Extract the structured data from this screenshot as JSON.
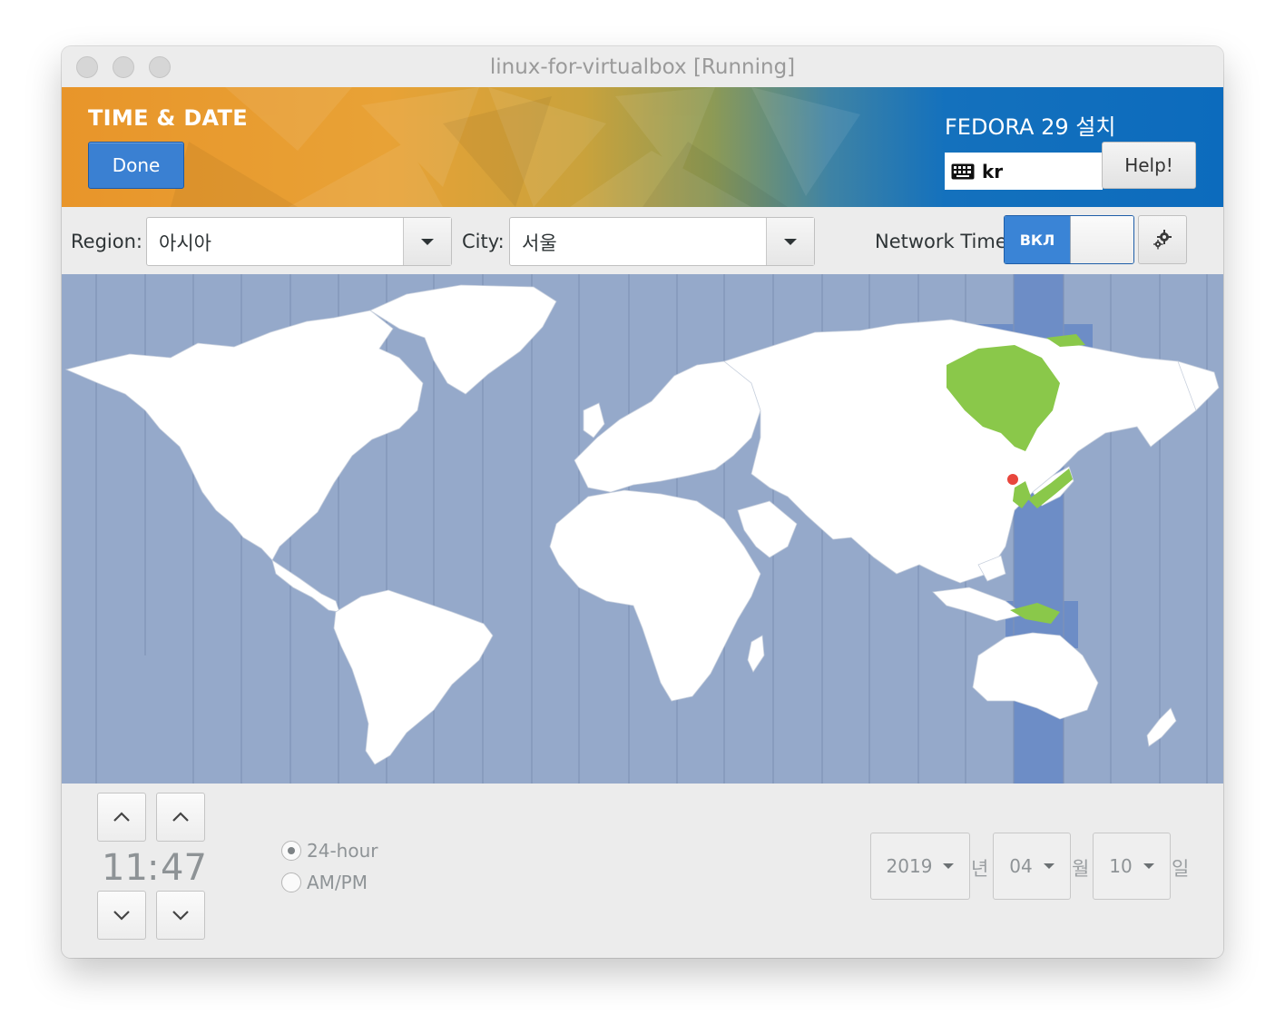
{
  "window": {
    "title": "linux-for-virtualbox [Running]"
  },
  "banner": {
    "spoke_title": "TIME & DATE",
    "done_label": "Done",
    "install_title": "FEDORA 29 설치",
    "keyboard_layout": "kr",
    "help_label": "Help!"
  },
  "toolbar": {
    "region_label": "Region:",
    "region_value": "아시아",
    "city_label": "City:",
    "city_value": "서울",
    "network_time_label": "Network Time",
    "network_time_state": "ВКЛ"
  },
  "map": {
    "selected_city_marker_color": "#e8463c",
    "timezone_highlight_color": "#6d8dc6",
    "selected_zone_land_color": "#8ac84a",
    "ocean_color": "#95a9ca"
  },
  "time": {
    "hours": "11",
    "separator": ":",
    "minutes": "47",
    "format_24h_label": "24-hour",
    "format_ampm_label": "AM/PM",
    "selected_format": "24-hour"
  },
  "date": {
    "year": "2019",
    "year_unit": "년",
    "month": "04",
    "month_unit": "월",
    "day": "10",
    "day_unit": "일"
  },
  "icons": {
    "keyboard": "keyboard-icon",
    "gear": "gear-icon",
    "dropdown": "chevron-down-icon",
    "up": "chevron-up-icon",
    "down": "chevron-down-icon"
  }
}
